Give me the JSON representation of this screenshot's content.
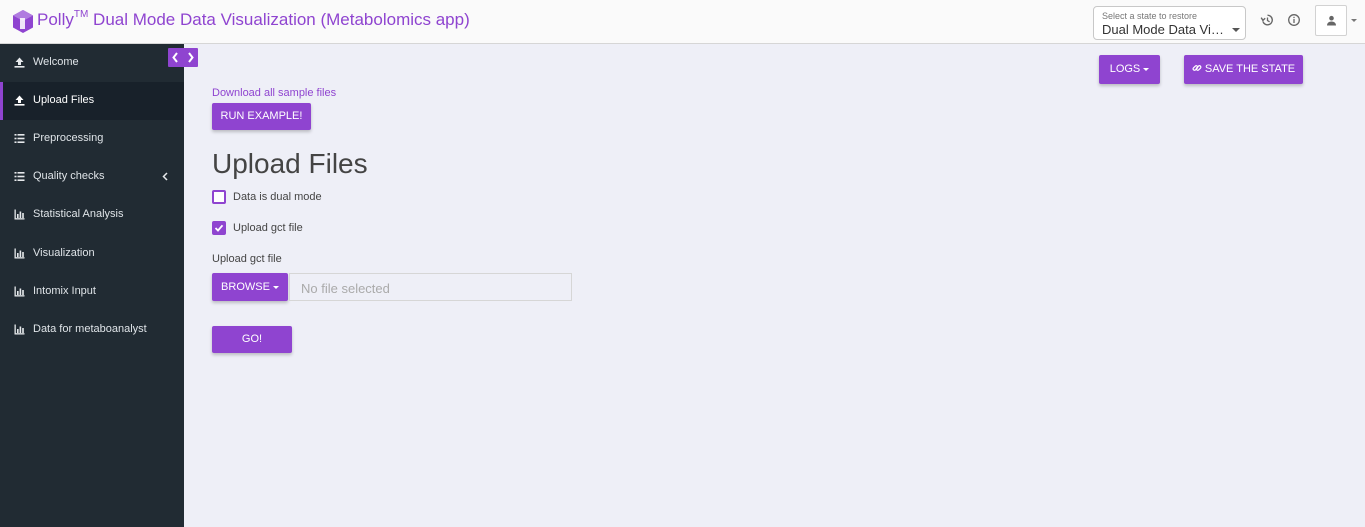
{
  "header": {
    "app_name": "Polly",
    "trademark": "TM",
    "app_subtitle": "Dual Mode Data Visualization (Metabolomics app)",
    "state_select": {
      "label": "Select a state to restore",
      "value": "Dual Mode Data Visu..."
    },
    "icons": [
      "history-icon",
      "info-icon",
      "user-icon"
    ]
  },
  "sidebar": {
    "items": [
      {
        "label": "Welcome",
        "icon": "upload-icon",
        "active": false
      },
      {
        "label": "Upload Files",
        "icon": "upload-icon",
        "active": true
      },
      {
        "label": "Preprocessing",
        "icon": "list-icon",
        "active": false
      },
      {
        "label": "Quality checks",
        "icon": "list-icon",
        "active": false,
        "expandable": true
      },
      {
        "label": "Statistical Analysis",
        "icon": "bar-chart-icon",
        "active": false
      },
      {
        "label": "Visualization",
        "icon": "bar-chart-icon",
        "active": false
      },
      {
        "label": "Intomix Input",
        "icon": "bar-chart-icon",
        "active": false
      },
      {
        "label": "Data for metaboanalyst",
        "icon": "bar-chart-icon",
        "active": false
      }
    ]
  },
  "toolbar": {
    "logs_label": "LOGS",
    "save_state_label": "SAVE THE STATE"
  },
  "main": {
    "download_link": "Download all sample files",
    "run_example_label": "RUN EXAMPLE!",
    "title": "Upload Files",
    "checkbox_dual_mode": {
      "label": "Data is dual mode",
      "checked": false
    },
    "checkbox_gct": {
      "label": "Upload gct file",
      "checked": true
    },
    "file_field": {
      "label": "Upload gct file",
      "browse_label": "BROWSE",
      "placeholder": "No file selected"
    },
    "go_label": "GO!"
  },
  "colors": {
    "accent": "#8f44d0",
    "sidebar_bg": "#212b33",
    "main_bg": "#eeeff7"
  }
}
